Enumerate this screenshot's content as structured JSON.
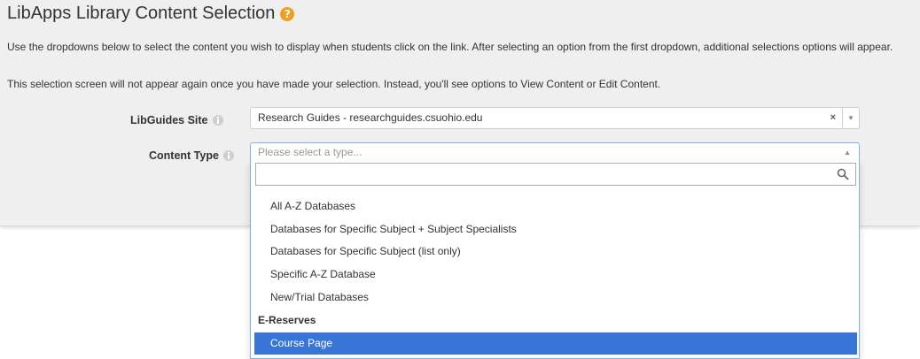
{
  "header": {
    "title": "LibApps Library Content Selection",
    "help_icon": "?"
  },
  "intro": {
    "line1": "Use the dropdowns below to select the content you wish to display when students click on the link. After selecting an option from the first dropdown, additional selections options will appear.",
    "line2": "This selection screen will not appear again once you have made your selection. Instead, you'll see options to View Content or Edit Content."
  },
  "fields": {
    "site": {
      "label": "LibGuides Site",
      "value": "Research Guides - researchguides.csuohio.edu",
      "clear": "×",
      "caret": "▼"
    },
    "content_type": {
      "label": "Content Type",
      "placeholder": "Please select a type...",
      "caret": "▲"
    }
  },
  "dropdown": {
    "search_value": "",
    "options": [
      "All A-Z Databases",
      "Databases for Specific Subject + Subject Specialists",
      "Databases for Specific Subject (list only)",
      "Specific A-Z Database",
      "New/Trial Databases"
    ],
    "group_label": "E-Reserves",
    "highlighted_option": "Course Page"
  },
  "colors": {
    "highlight": "#3875d7",
    "help_badge": "#f0a020",
    "focus_border": "#7fb0e6"
  }
}
